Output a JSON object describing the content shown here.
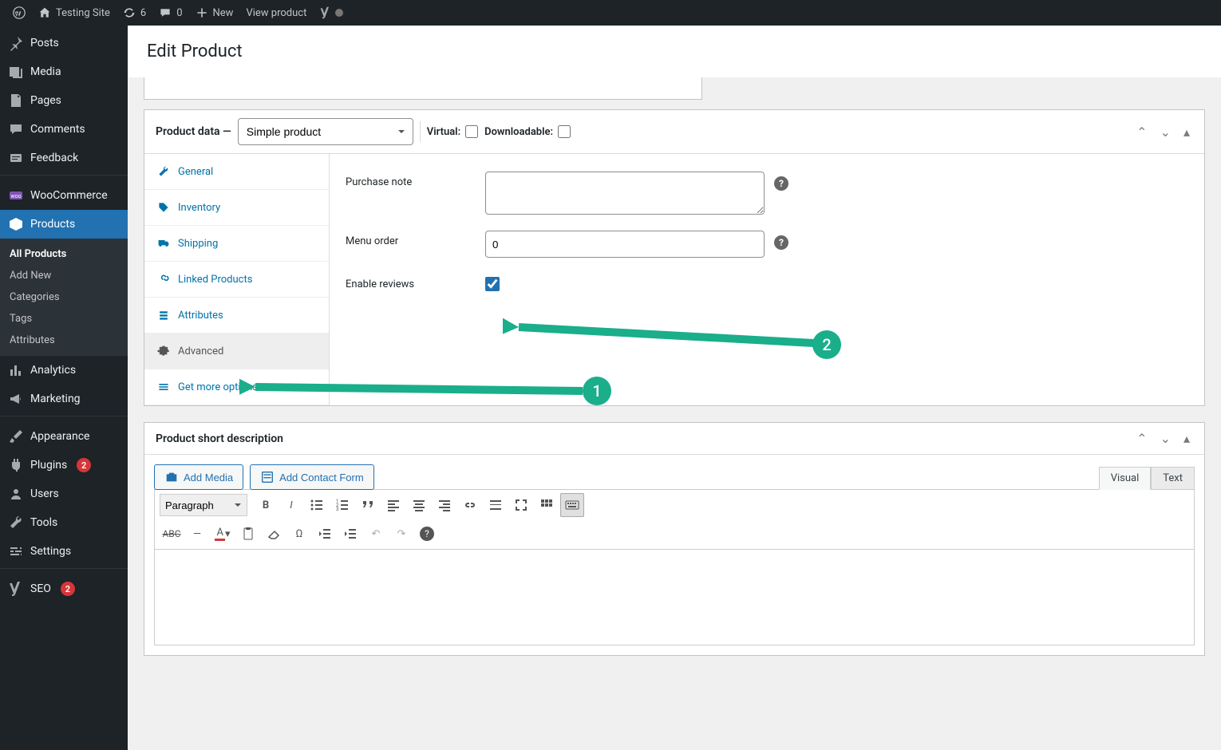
{
  "topbar": {
    "site_name": "Testing Site",
    "updates_count": "6",
    "comments_count": "0",
    "new_label": "New",
    "view_product_label": "View product"
  },
  "sidebar": {
    "items": {
      "posts": "Posts",
      "media": "Media",
      "pages": "Pages",
      "comments": "Comments",
      "feedback": "Feedback",
      "woocommerce": "WooCommerce",
      "products": "Products",
      "analytics": "Analytics",
      "marketing": "Marketing",
      "appearance": "Appearance",
      "plugins": "Plugins",
      "plugins_badge": "2",
      "users": "Users",
      "tools": "Tools",
      "settings": "Settings",
      "seo": "SEO",
      "seo_badge": "2"
    },
    "products_sub": {
      "all": "All Products",
      "add": "Add New",
      "categories": "Categories",
      "tags": "Tags",
      "attributes": "Attributes"
    }
  },
  "page": {
    "title": "Edit Product"
  },
  "product_data": {
    "title": "Product data —",
    "type_selected": "Simple product",
    "virtual_label": "Virtual:",
    "downloadable_label": "Downloadable:",
    "tabs": {
      "general": "General",
      "inventory": "Inventory",
      "shipping": "Shipping",
      "linked": "Linked Products",
      "attributes": "Attributes",
      "advanced": "Advanced",
      "more": "Get more options"
    },
    "fields": {
      "purchase_note": "Purchase note",
      "menu_order": "Menu order",
      "menu_order_value": "0",
      "enable_reviews": "Enable reviews"
    }
  },
  "short_desc": {
    "title": "Product short description",
    "add_media": "Add Media",
    "add_contact": "Add Contact Form",
    "visual_tab": "Visual",
    "text_tab": "Text",
    "paragraph": "Paragraph"
  },
  "annotations": {
    "one": "1",
    "two": "2"
  }
}
